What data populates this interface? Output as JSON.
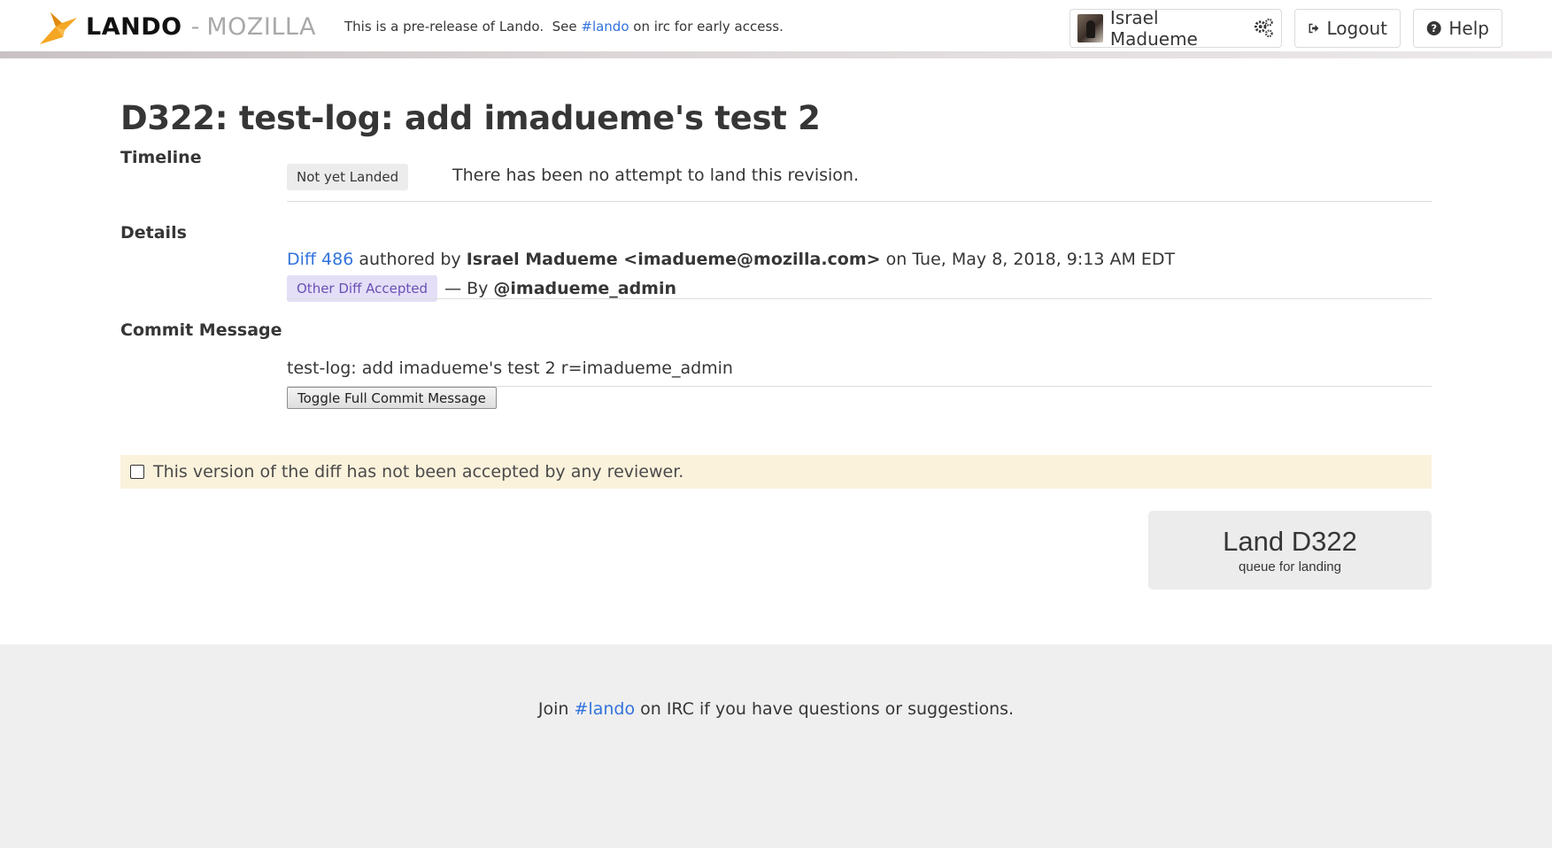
{
  "header": {
    "brand_name": "LANDO",
    "brand_separator": "-",
    "brand_org": "MOZILLA",
    "prerelease_prefix": "This is a pre-release of Lando.  See ",
    "prerelease_link": "#lando",
    "prerelease_suffix": " on irc for early access.",
    "user_name": "Israel Madueme",
    "logout_label": "Logout",
    "help_label": "Help"
  },
  "revision": {
    "title": "D322: test-log: add imadueme's test 2",
    "timeline_label": "Timeline",
    "timeline_status": "Not yet Landed",
    "timeline_text": "There has been no attempt to land this revision.",
    "details_label": "Details",
    "diff_link": "Diff 486",
    "authored_by": " authored by ",
    "author": "Israel Madueme <imadueme@mozilla.com>",
    "authored_on": " on Tue, May 8, 2018, 9:13 AM EDT",
    "review_status": "Other Diff Accepted",
    "review_by_prefix": "— By ",
    "reviewer": "@imadueme_admin",
    "commit_label": "Commit Message",
    "commit_message": "test-log: add imadueme's test 2 r=imadueme_admin",
    "toggle_commit_label": "Toggle Full Commit Message"
  },
  "warning": {
    "text": "This version of the diff has not been accepted by any reviewer.",
    "checked": false
  },
  "land_button": {
    "title": "Land D322",
    "subtitle": "queue for landing"
  },
  "footer": {
    "prefix": "Join ",
    "link": "#lando",
    "suffix": " on IRC if you have questions or suggestions."
  },
  "colors": {
    "link": "#3273dc",
    "warning_bg": "#fbf2dc",
    "accent_logo": "#f5a623",
    "tag_purple_bg": "#e4dff7",
    "tag_purple_text": "#6a4fb5"
  },
  "icons": {
    "logo": "lando-bird-logo",
    "settings": "gears-icon",
    "logout": "sign-out-icon",
    "help": "question-circle-icon"
  }
}
